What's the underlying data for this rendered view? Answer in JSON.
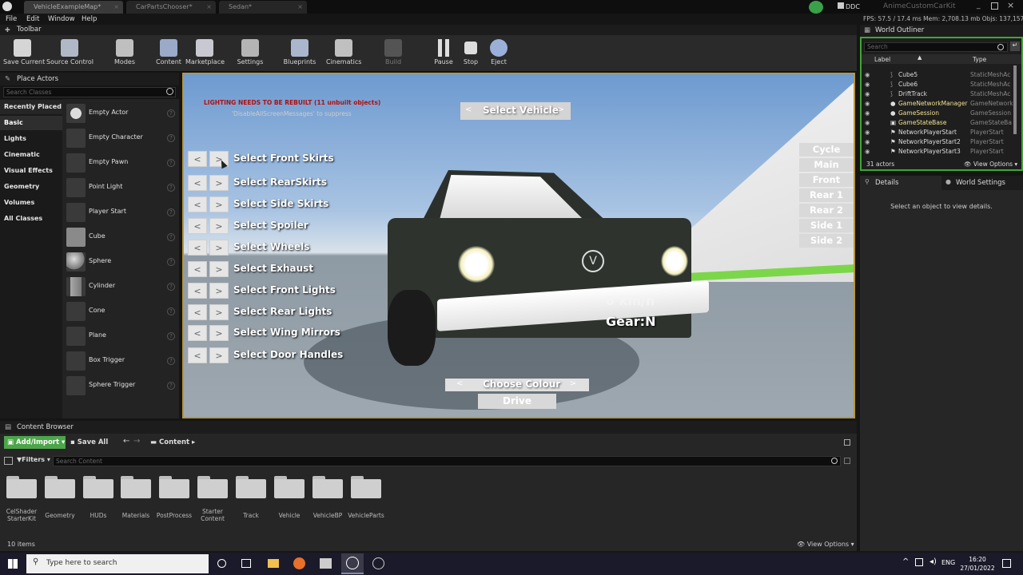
{
  "title_bar": {
    "tabs": [
      "VehicleExampleMap*",
      "CarPartsChooser*",
      "Sedan*"
    ],
    "ddc_label": "DDC",
    "project_name": "AnimeCustomCarKit"
  },
  "menu": [
    "File",
    "Edit",
    "Window",
    "Help"
  ],
  "stats": "FPS: 57.5 / 17.4 ms  Mem: 2,708.13 mb  Objs: 137,157",
  "toolbar": {
    "title": "Toolbar",
    "buttons": [
      "Save Current",
      "Source Control",
      "Modes",
      "Content",
      "Marketplace",
      "Settings",
      "Blueprints",
      "Cinematics",
      "Build",
      "Pause",
      "Stop",
      "Eject"
    ]
  },
  "place_actors": {
    "title": "Place Actors",
    "search_placeholder": "Search Classes",
    "categories": [
      "Recently Placed",
      "Basic",
      "Lights",
      "Cinematic",
      "Visual Effects",
      "Geometry",
      "Volumes",
      "All Classes"
    ],
    "items": [
      "Empty Actor",
      "Empty Character",
      "Empty Pawn",
      "Point Light",
      "Player Start",
      "Cube",
      "Sphere",
      "Cylinder",
      "Cone",
      "Plane",
      "Box Trigger",
      "Sphere Trigger"
    ]
  },
  "viewport": {
    "warning": "LIGHTING NEEDS TO BE REBUILT (11 unbuilt objects)",
    "warning_sub": "'DisableAllScreenMessages' to suppress",
    "select_vehicle": "Select Vehicle",
    "prev": "<",
    "next": ">",
    "parts": [
      "Select Front Skirts",
      "Select RearSkirts",
      "Select Side Skirts",
      "Select Spoiler",
      "Select Wheels",
      "Select Exhaust",
      "Select Front Lights",
      "Select Rear Lights",
      "Select Wing Mirrors",
      "Select Door Handles"
    ],
    "cameras": [
      "Cycle View",
      "Main",
      "Front",
      "Rear 1",
      "Rear 2",
      "Side 1",
      "Side 2"
    ],
    "speed": "0 km/h",
    "gear": "Gear:N",
    "choose_colour": "Choose Colour",
    "drive": "Drive"
  },
  "world_outliner": {
    "title": "World Outliner",
    "search_placeholder": "Search",
    "col_label": "Label",
    "col_type": "Type",
    "rows": [
      {
        "label": "Cube5",
        "type": "StaticMeshAc"
      },
      {
        "label": "Cube6",
        "type": "StaticMeshAc"
      },
      {
        "label": "DriftTrack",
        "type": "StaticMeshAc"
      },
      {
        "label": "GameNetworkManager",
        "type": "GameNetwork"
      },
      {
        "label": "GameSession",
        "type": "GameSession"
      },
      {
        "label": "GameStateBase",
        "type": "GameStateBa"
      },
      {
        "label": "NetworkPlayerStart",
        "type": "PlayerStart"
      },
      {
        "label": "NetworkPlayerStart2",
        "type": "PlayerStart"
      },
      {
        "label": "NetworkPlayerStart3",
        "type": "PlayerStart"
      }
    ],
    "count": "31 actors",
    "view_options": "View Options"
  },
  "details": {
    "tab_details": "Details",
    "tab_world": "World Settings",
    "empty": "Select an object to view details."
  },
  "content_browser": {
    "title": "Content Browser",
    "add_import": "Add/Import",
    "save_all": "Save All",
    "path": "Content",
    "filters": "Filters",
    "search_placeholder": "Search Content",
    "folders": [
      "CelShader StarterKit",
      "Geometry",
      "HUDs",
      "Materials",
      "PostProcess",
      "Starter Content",
      "Track",
      "Vehicle",
      "VehicleBP",
      "VehicleParts"
    ],
    "items_count": "10 items",
    "view_options": "View Options"
  },
  "taskbar": {
    "search_placeholder": "Type here to search",
    "lang": "ENG",
    "time": "16:20",
    "date": "27/01/2022"
  }
}
